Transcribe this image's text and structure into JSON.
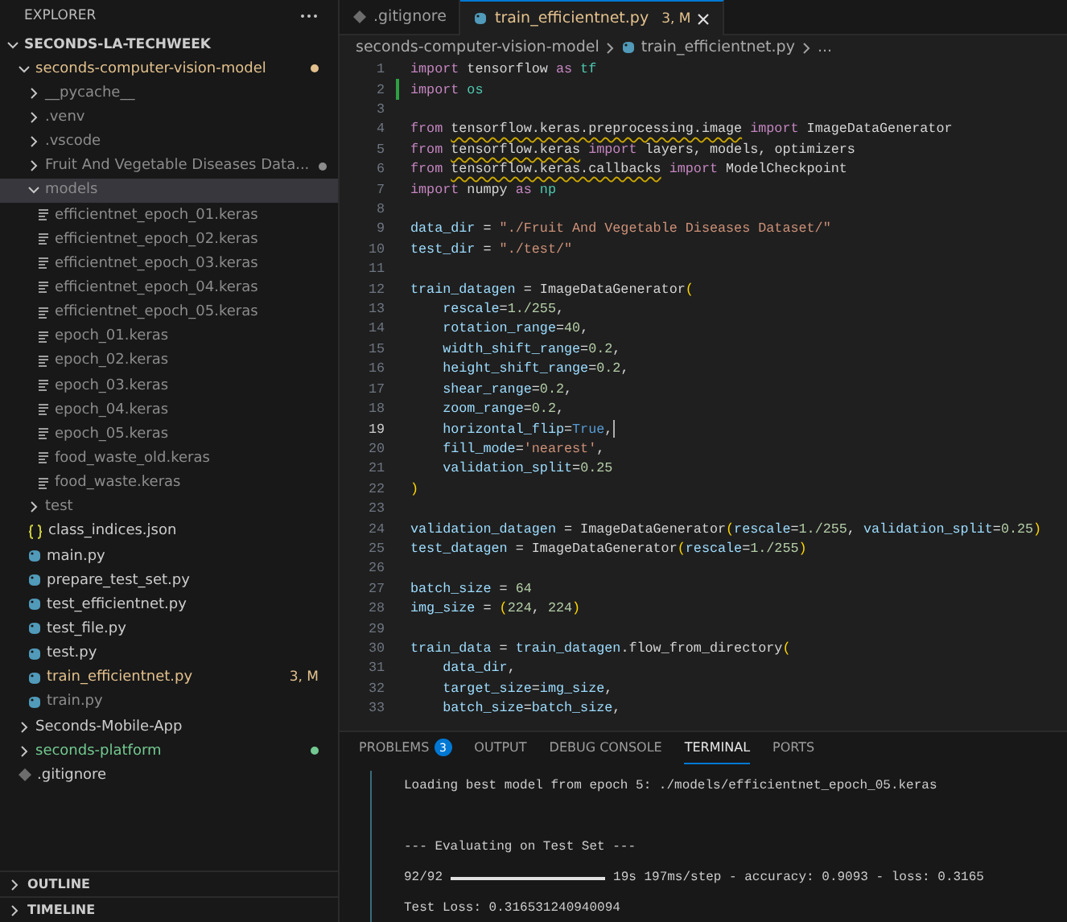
{
  "explorer": {
    "title": "EXPLORER",
    "workspace": {
      "label": "SECONDS-LA-TECHWEEK",
      "expanded": true
    },
    "items": [
      {
        "label": "seconds-computer-vision-model",
        "kind": "folder",
        "expanded": true,
        "selected": false,
        "color": "#e2c08d",
        "dot": true,
        "children": [
          {
            "label": "__pycache__",
            "kind": "folder",
            "expanded": false,
            "selected": false,
            "color": "#8c8c8c",
            "dot": false
          },
          {
            "label": ".venv",
            "kind": "folder",
            "expanded": false,
            "selected": false,
            "color": "#8c8c8c",
            "dot": false
          },
          {
            "label": ".vscode",
            "kind": "folder",
            "expanded": false,
            "selected": false,
            "color": "#8c8c8c",
            "dot": false
          },
          {
            "label": "Fruit And Vegetable Diseases Data...",
            "kind": "folder",
            "expanded": false,
            "selected": false,
            "color": "#8c8c8c",
            "dot": true
          },
          {
            "label": "models",
            "kind": "folder",
            "expanded": true,
            "selected": true,
            "color": "#8c8c8c",
            "dot": false,
            "children": [
              {
                "label": "efficientnet_epoch_01.keras",
                "kind": "keras",
                "selected": false,
                "color": "#8c8c8c",
                "dot": false
              },
              {
                "label": "efficientnet_epoch_02.keras",
                "kind": "keras",
                "selected": false,
                "color": "#8c8c8c",
                "dot": false
              },
              {
                "label": "efficientnet_epoch_03.keras",
                "kind": "keras",
                "selected": false,
                "color": "#8c8c8c",
                "dot": false
              },
              {
                "label": "efficientnet_epoch_04.keras",
                "kind": "keras",
                "selected": false,
                "color": "#8c8c8c",
                "dot": false
              },
              {
                "label": "efficientnet_epoch_05.keras",
                "kind": "keras",
                "selected": false,
                "color": "#8c8c8c",
                "dot": false
              },
              {
                "label": "epoch_01.keras",
                "kind": "keras",
                "selected": false,
                "color": "#8c8c8c",
                "dot": false
              },
              {
                "label": "epoch_02.keras",
                "kind": "keras",
                "selected": false,
                "color": "#8c8c8c",
                "dot": false
              },
              {
                "label": "epoch_03.keras",
                "kind": "keras",
                "selected": false,
                "color": "#8c8c8c",
                "dot": false
              },
              {
                "label": "epoch_04.keras",
                "kind": "keras",
                "selected": false,
                "color": "#8c8c8c",
                "dot": false
              },
              {
                "label": "epoch_05.keras",
                "kind": "keras",
                "selected": false,
                "color": "#8c8c8c",
                "dot": false
              },
              {
                "label": "food_waste_old.keras",
                "kind": "keras",
                "selected": false,
                "color": "#8c8c8c",
                "dot": false
              },
              {
                "label": "food_waste.keras",
                "kind": "keras",
                "selected": false,
                "color": "#8c8c8c",
                "dot": false
              }
            ]
          },
          {
            "label": "test",
            "kind": "folder",
            "expanded": false,
            "selected": false,
            "color": "#8c8c8c",
            "dot": false
          },
          {
            "label": "class_indices.json",
            "kind": "json",
            "selected": false,
            "color": "#cccccc",
            "dot": false
          },
          {
            "label": "main.py",
            "kind": "python",
            "selected": false,
            "color": "#cccccc",
            "dot": false
          },
          {
            "label": "prepare_test_set.py",
            "kind": "python",
            "selected": false,
            "color": "#cccccc",
            "dot": false
          },
          {
            "label": "test_efficientnet.py",
            "kind": "python",
            "selected": false,
            "color": "#cccccc",
            "dot": false
          },
          {
            "label": "test_file.py",
            "kind": "python",
            "selected": false,
            "color": "#cccccc",
            "dot": false
          },
          {
            "label": "test.py",
            "kind": "python",
            "selected": false,
            "color": "#cccccc",
            "dot": false
          },
          {
            "label": "train_efficientnet.py",
            "kind": "python",
            "selected": false,
            "color": "#e2c08d",
            "dot": false,
            "badge": "3, M"
          },
          {
            "label": "train.py",
            "kind": "python",
            "selected": false,
            "color": "#8c8c8c",
            "dot": false
          }
        ]
      },
      {
        "label": "Seconds-Mobile-App",
        "kind": "folder",
        "expanded": false,
        "selected": false,
        "color": "#cccccc",
        "dot": false
      },
      {
        "label": "seconds-platform",
        "kind": "folder",
        "expanded": false,
        "selected": false,
        "color": "#73c991",
        "dot": true
      },
      {
        "label": ".gitignore",
        "kind": "gitignore",
        "selected": false,
        "color": "#cccccc",
        "dot": false
      }
    ],
    "sections": [
      {
        "label": "OUTLINE",
        "expanded": false
      },
      {
        "label": "TIMELINE",
        "expanded": false
      }
    ]
  },
  "tabs": [
    {
      "label": ".gitignore",
      "kind": "gitignore",
      "selected": false,
      "color": "#9d9d9d"
    },
    {
      "label": "train_efficientnet.py",
      "kind": "python",
      "selected": true,
      "color": "#e2c08d",
      "badge": "3, M"
    }
  ],
  "breadcrumbs": [
    {
      "label": "seconds-computer-vision-model",
      "kind": "folder"
    },
    {
      "label": "train_efficientnet.py",
      "kind": "python"
    },
    {
      "label": "...",
      "kind": "symbol"
    }
  ],
  "code": [
    {
      "number": "1",
      "current": false,
      "added": false,
      "tokens": [
        {
          "text": "import",
          "kind": "kw"
        },
        {
          "text": " tensorflow ",
          "kind": "plain"
        },
        {
          "text": "as",
          "kind": "kw"
        },
        {
          "text": " tf",
          "kind": "mod"
        }
      ]
    },
    {
      "number": "2",
      "current": false,
      "added": true,
      "tokens": [
        {
          "text": "import",
          "kind": "kw"
        },
        {
          "text": " os",
          "kind": "mod"
        }
      ]
    },
    {
      "number": "3",
      "current": false,
      "added": false
    },
    {
      "number": "4",
      "current": false,
      "added": false,
      "tokens": [
        {
          "text": "from ",
          "kind": "kw"
        },
        {
          "text": "tensorflow.keras.preprocessing.image",
          "kind": "warn"
        },
        {
          "text": " import",
          "kind": "kw"
        },
        {
          "text": " ImageDataGenerator",
          "kind": "plain"
        }
      ]
    },
    {
      "number": "5",
      "current": false,
      "added": false,
      "tokens": [
        {
          "text": "from ",
          "kind": "kw"
        },
        {
          "text": "tensorflow.keras",
          "kind": "warn"
        },
        {
          "text": " import",
          "kind": "kw"
        },
        {
          "text": " layers, models, optimizers",
          "kind": "plain"
        }
      ]
    },
    {
      "number": "6",
      "current": false,
      "added": false,
      "tokens": [
        {
          "text": "from ",
          "kind": "kw"
        },
        {
          "text": "tensorflow.keras.callbacks",
          "kind": "warn"
        },
        {
          "text": " import",
          "kind": "kw"
        },
        {
          "text": " ModelCheckpoint",
          "kind": "plain"
        }
      ]
    },
    {
      "number": "7",
      "current": false,
      "added": false,
      "tokens": [
        {
          "text": "import",
          "kind": "kw"
        },
        {
          "text": " numpy ",
          "kind": "plain"
        },
        {
          "text": "as",
          "kind": "kw"
        },
        {
          "text": " np",
          "kind": "mod"
        }
      ]
    },
    {
      "number": "8",
      "current": false,
      "added": false
    },
    {
      "number": "9",
      "current": false,
      "added": false,
      "tokens": [
        {
          "text": "data_dir",
          "kind": "var"
        },
        {
          "text": " = ",
          "kind": "plain"
        },
        {
          "text": "\"./Fruit And Vegetable Diseases Dataset/\"",
          "kind": "str"
        }
      ]
    },
    {
      "number": "10",
      "current": false,
      "added": false,
      "tokens": [
        {
          "text": "test_dir",
          "kind": "var"
        },
        {
          "text": " = ",
          "kind": "plain"
        },
        {
          "text": "\"./test/\"",
          "kind": "str"
        }
      ]
    },
    {
      "number": "11",
      "current": false,
      "added": false
    },
    {
      "number": "12",
      "current": false,
      "added": false,
      "tokens": [
        {
          "text": "train_datagen",
          "kind": "var"
        },
        {
          "text": " = ImageDataGenerator",
          "kind": "plain"
        },
        {
          "text": "(",
          "kind": "bracket"
        }
      ]
    },
    {
      "number": "13",
      "current": false,
      "added": false,
      "tokens": [
        {
          "text": "    rescale",
          "kind": "var"
        },
        {
          "text": "=",
          "kind": "plain"
        },
        {
          "text": "1./255",
          "kind": "num"
        },
        {
          "text": ",",
          "kind": "plain"
        }
      ]
    },
    {
      "number": "14",
      "current": false,
      "added": false,
      "tokens": [
        {
          "text": "    rotation_range",
          "kind": "var"
        },
        {
          "text": "=",
          "kind": "plain"
        },
        {
          "text": "40",
          "kind": "num"
        },
        {
          "text": ",",
          "kind": "plain"
        }
      ]
    },
    {
      "number": "15",
      "current": false,
      "added": false,
      "tokens": [
        {
          "text": "    width_shift_range",
          "kind": "var"
        },
        {
          "text": "=",
          "kind": "plain"
        },
        {
          "text": "0.2",
          "kind": "num"
        },
        {
          "text": ",",
          "kind": "plain"
        }
      ]
    },
    {
      "number": "16",
      "current": false,
      "added": false,
      "tokens": [
        {
          "text": "    height_shift_range",
          "kind": "var"
        },
        {
          "text": "=",
          "kind": "plain"
        },
        {
          "text": "0.2",
          "kind": "num"
        },
        {
          "text": ",",
          "kind": "plain"
        }
      ]
    },
    {
      "number": "17",
      "current": false,
      "added": false,
      "tokens": [
        {
          "text": "    shear_range",
          "kind": "var"
        },
        {
          "text": "=",
          "kind": "plain"
        },
        {
          "text": "0.2",
          "kind": "num"
        },
        {
          "text": ",",
          "kind": "plain"
        }
      ]
    },
    {
      "number": "18",
      "current": false,
      "added": false,
      "tokens": [
        {
          "text": "    zoom_range",
          "kind": "var"
        },
        {
          "text": "=",
          "kind": "plain"
        },
        {
          "text": "0.2",
          "kind": "num"
        },
        {
          "text": ",",
          "kind": "plain"
        }
      ]
    },
    {
      "number": "19",
      "current": true,
      "added": false,
      "tokens": [
        {
          "text": "    horizontal_flip",
          "kind": "var"
        },
        {
          "text": "=",
          "kind": "plain"
        },
        {
          "text": "True",
          "kind": "const"
        },
        {
          "text": ",",
          "kind": "plain"
        }
      ]
    },
    {
      "number": "20",
      "current": false,
      "added": false,
      "tokens": [
        {
          "text": "    fill_mode",
          "kind": "var"
        },
        {
          "text": "=",
          "kind": "plain"
        },
        {
          "text": "'nearest'",
          "kind": "str"
        },
        {
          "text": ",",
          "kind": "plain"
        }
      ]
    },
    {
      "number": "21",
      "current": false,
      "added": false,
      "tokens": [
        {
          "text": "    validation_split",
          "kind": "var"
        },
        {
          "text": "=",
          "kind": "plain"
        },
        {
          "text": "0.25",
          "kind": "num"
        }
      ]
    },
    {
      "number": "22",
      "current": false,
      "added": false,
      "tokens": [
        {
          "text": ")",
          "kind": "bracket"
        }
      ]
    },
    {
      "number": "23",
      "current": false,
      "added": false
    },
    {
      "number": "24",
      "current": false,
      "added": false,
      "tokens": [
        {
          "text": "validation_datagen",
          "kind": "var"
        },
        {
          "text": " = ImageDataGenerator",
          "kind": "plain"
        },
        {
          "text": "(",
          "kind": "bracket"
        },
        {
          "text": "rescale",
          "kind": "var"
        },
        {
          "text": "=",
          "kind": "plain"
        },
        {
          "text": "1./255",
          "kind": "num"
        },
        {
          "text": ", ",
          "kind": "plain"
        },
        {
          "text": "validation_split",
          "kind": "var"
        },
        {
          "text": "=",
          "kind": "plain"
        },
        {
          "text": "0.25",
          "kind": "num"
        },
        {
          "text": ")",
          "kind": "bracket"
        }
      ]
    },
    {
      "number": "25",
      "current": false,
      "added": false,
      "tokens": [
        {
          "text": "test_datagen",
          "kind": "var"
        },
        {
          "text": " = ImageDataGenerator",
          "kind": "plain"
        },
        {
          "text": "(",
          "kind": "bracket"
        },
        {
          "text": "rescale",
          "kind": "var"
        },
        {
          "text": "=",
          "kind": "plain"
        },
        {
          "text": "1./255",
          "kind": "num"
        },
        {
          "text": ")",
          "kind": "bracket"
        }
      ]
    },
    {
      "number": "26",
      "current": false,
      "added": false
    },
    {
      "number": "27",
      "current": false,
      "added": false,
      "tokens": [
        {
          "text": "batch_size",
          "kind": "var"
        },
        {
          "text": " = ",
          "kind": "plain"
        },
        {
          "text": "64",
          "kind": "num"
        }
      ]
    },
    {
      "number": "28",
      "current": false,
      "added": false,
      "tokens": [
        {
          "text": "img_size",
          "kind": "var"
        },
        {
          "text": " = ",
          "kind": "plain"
        },
        {
          "text": "(",
          "kind": "bracket"
        },
        {
          "text": "224",
          "kind": "num"
        },
        {
          "text": ", ",
          "kind": "plain"
        },
        {
          "text": "224",
          "kind": "num"
        },
        {
          "text": ")",
          "kind": "bracket"
        }
      ]
    },
    {
      "number": "29",
      "current": false,
      "added": false
    },
    {
      "number": "30",
      "current": false,
      "added": false,
      "tokens": [
        {
          "text": "train_data",
          "kind": "var"
        },
        {
          "text": " = ",
          "kind": "plain"
        },
        {
          "text": "train_datagen",
          "kind": "var"
        },
        {
          "text": ".flow_from_directory",
          "kind": "plain"
        },
        {
          "text": "(",
          "kind": "bracket"
        }
      ]
    },
    {
      "number": "31",
      "current": false,
      "added": false,
      "tokens": [
        {
          "text": "    data_dir",
          "kind": "var"
        },
        {
          "text": ",",
          "kind": "plain"
        }
      ]
    },
    {
      "number": "32",
      "current": false,
      "added": false,
      "tokens": [
        {
          "text": "    target_size",
          "kind": "var"
        },
        {
          "text": "=",
          "kind": "plain"
        },
        {
          "text": "img_size",
          "kind": "var"
        },
        {
          "text": ",",
          "kind": "plain"
        }
      ]
    },
    {
      "number": "33",
      "current": false,
      "added": false,
      "tokens": [
        {
          "text": "    batch_size",
          "kind": "var"
        },
        {
          "text": "=",
          "kind": "plain"
        },
        {
          "text": "batch_size",
          "kind": "var"
        },
        {
          "text": ",",
          "kind": "plain"
        }
      ]
    }
  ],
  "panel": {
    "tabs": [
      {
        "label": "PROBLEMS",
        "selected": false,
        "badge": "3"
      },
      {
        "label": "OUTPUT",
        "selected": false
      },
      {
        "label": "DEBUG CONSOLE",
        "selected": false
      },
      {
        "label": "TERMINAL",
        "selected": true
      },
      {
        "label": "PORTS",
        "selected": false
      }
    ],
    "terminal": [
      {
        "kind": "text",
        "text": "Loading best model from epoch 5: ./models/efficientnet_epoch_05.keras"
      },
      {
        "kind": "blank"
      },
      {
        "kind": "text",
        "text": "--- Evaluating on Test Set ---"
      },
      {
        "kind": "progress",
        "before": "92/92",
        "level": 1,
        "after": "19s 197ms/step - accuracy: 0.9093 - loss: 0.3165"
      },
      {
        "kind": "text",
        "text": "Test Loss: 0.316531240940094"
      }
    ]
  }
}
